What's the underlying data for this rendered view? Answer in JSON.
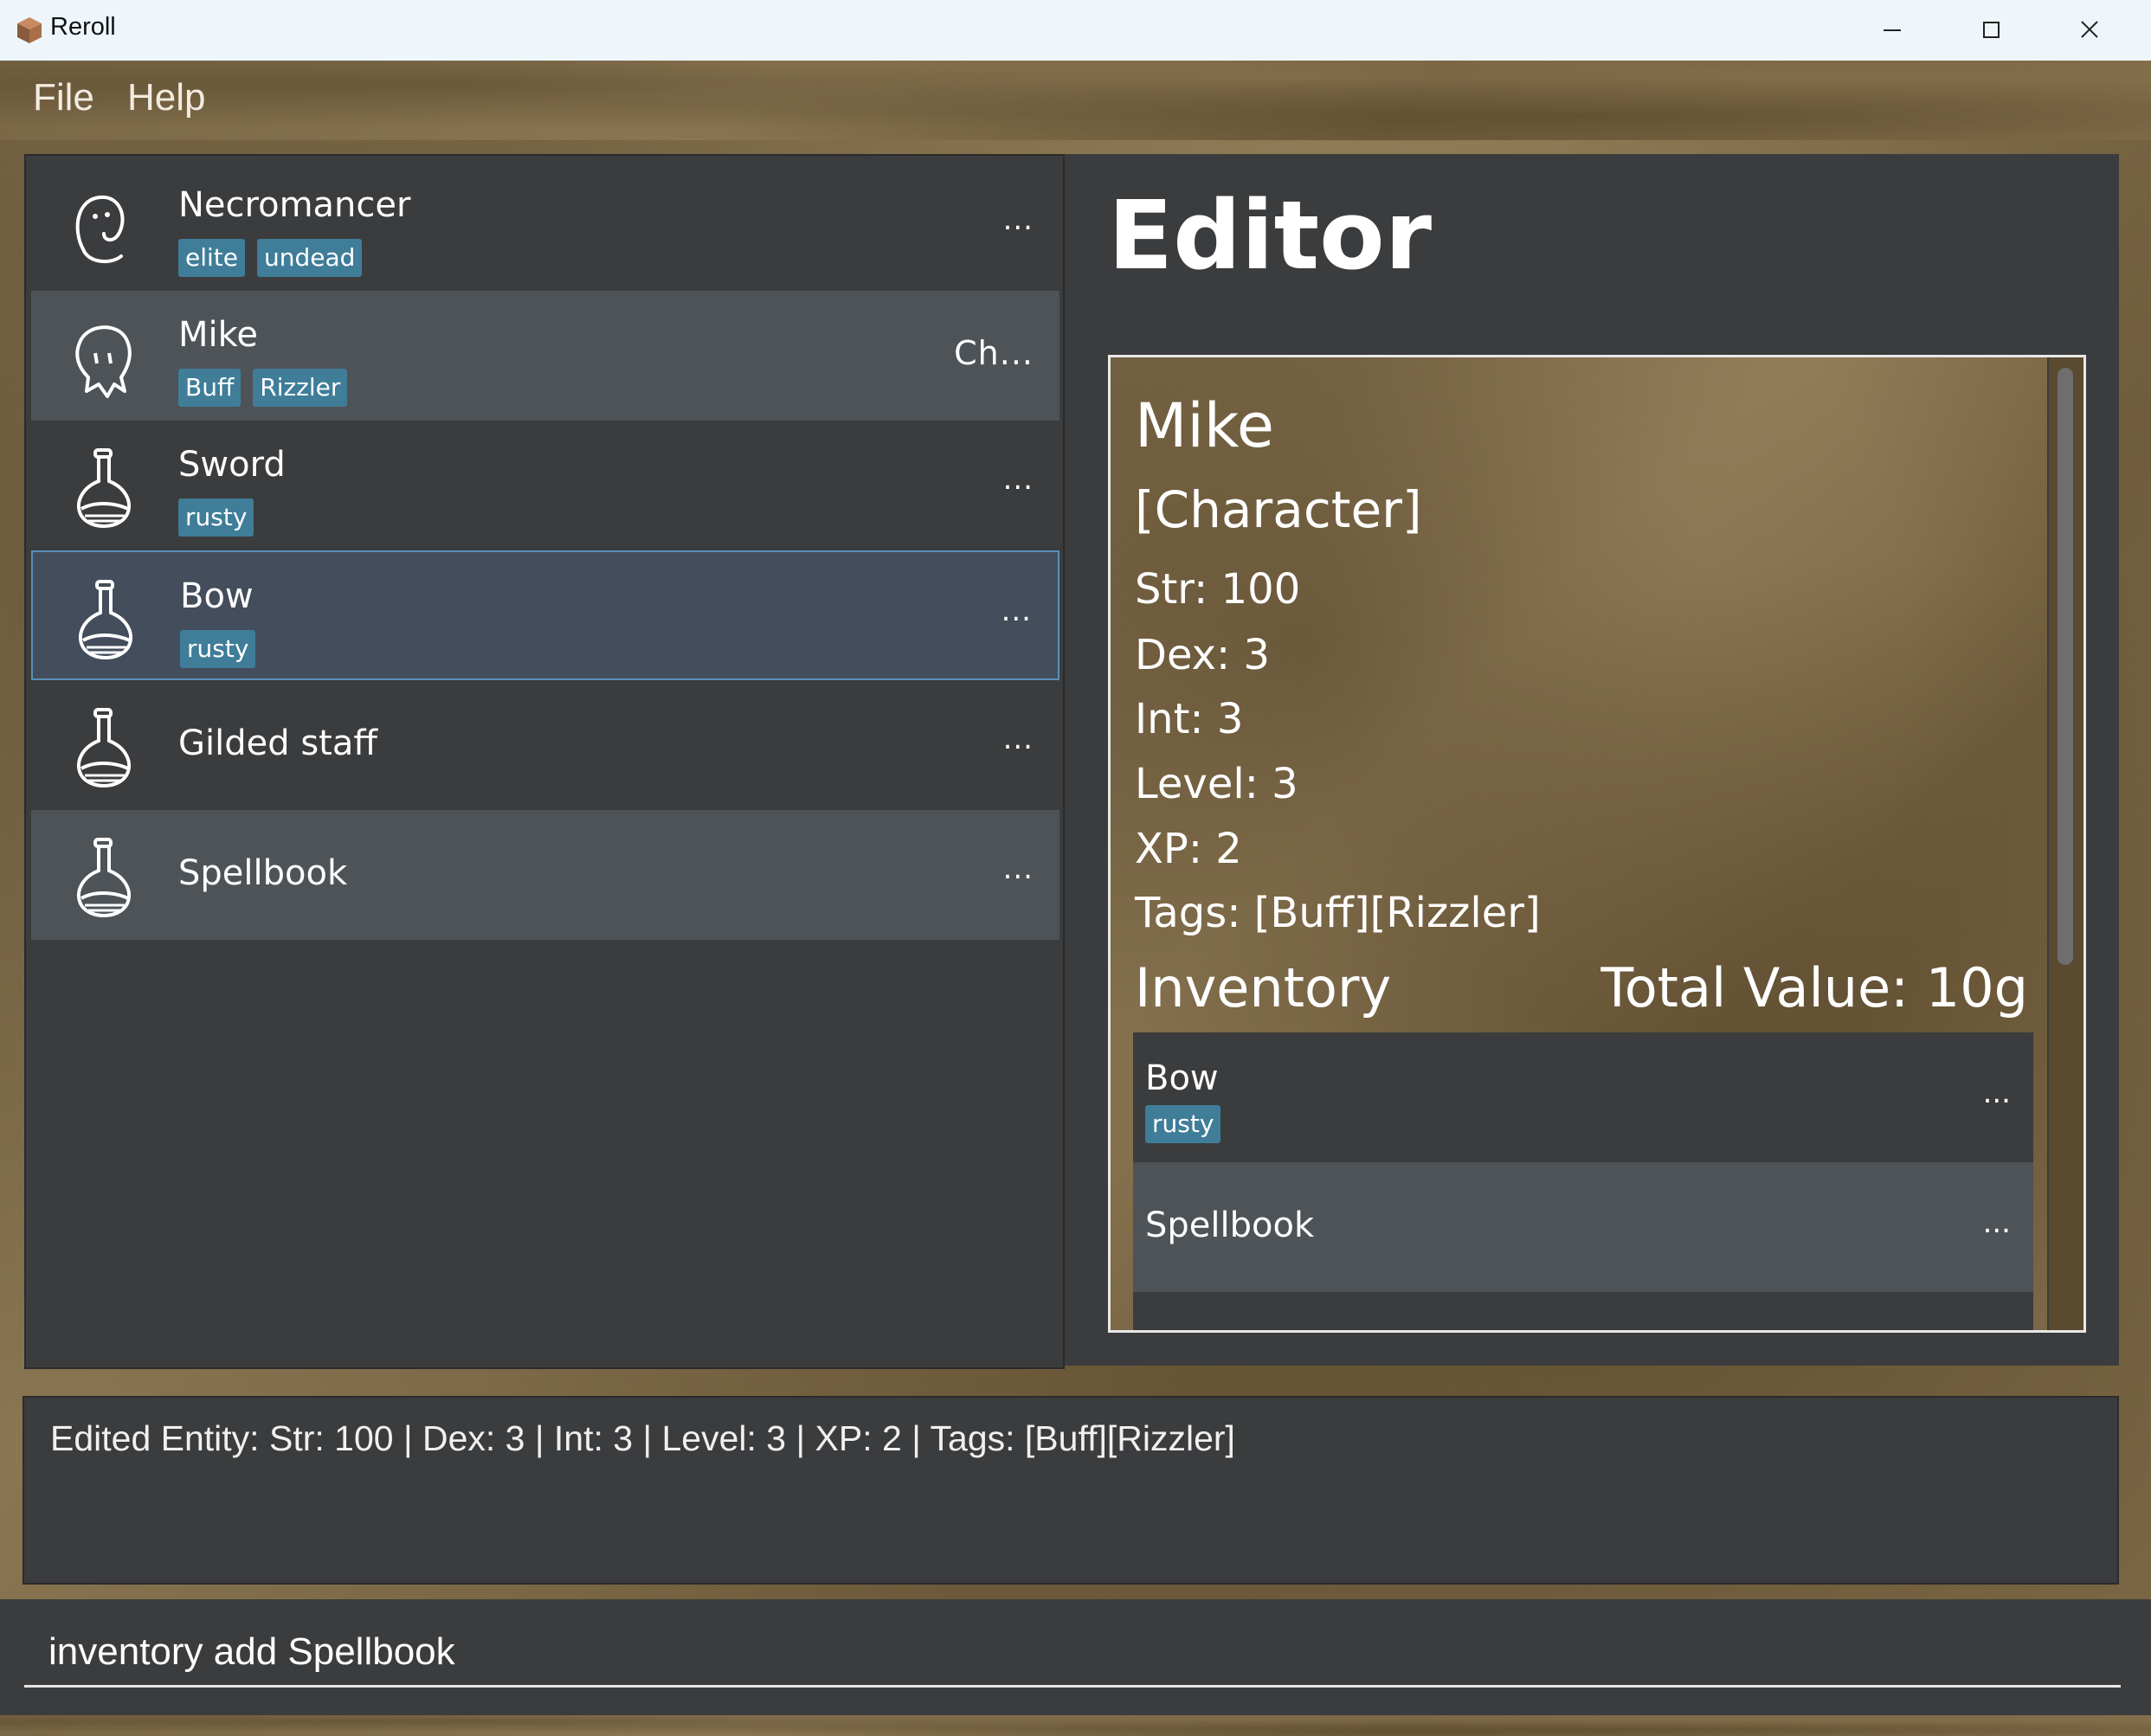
{
  "window": {
    "title": "Reroll",
    "minimize_icon": "minimize-icon",
    "maximize_icon": "maximize-icon",
    "close_icon": "close-icon"
  },
  "menu": {
    "file": "File",
    "help": "Help"
  },
  "entities": [
    {
      "name": "Necromancer",
      "icon": "ghost-icon",
      "tags": [
        "elite",
        "undead"
      ],
      "more": "...",
      "style": "normal"
    },
    {
      "name": "Mike",
      "icon": "ghost-face-icon",
      "tags": [
        "Buff",
        "Rizzler"
      ],
      "more": "Ch...",
      "style": "alt"
    },
    {
      "name": "Sword",
      "icon": "potion-flask-icon",
      "tags": [
        "rusty"
      ],
      "more": "...",
      "style": "normal"
    },
    {
      "name": "Bow",
      "icon": "potion-flask-icon",
      "tags": [
        "rusty"
      ],
      "more": "...",
      "style": "selected"
    },
    {
      "name": "Gilded staff",
      "icon": "potion-flask-icon",
      "tags": [],
      "more": "...",
      "style": "normal"
    },
    {
      "name": "Spellbook",
      "icon": "potion-flask-icon",
      "tags": [],
      "more": "...",
      "style": "alt"
    }
  ],
  "editor": {
    "title": "Editor",
    "name": "Mike",
    "type": "[Character]",
    "str": "Str: 100",
    "dex": "Dex: 3",
    "int": "Int: 3",
    "level": "Level: 3",
    "xp": "XP: 2",
    "tags": "Tags: [Buff][Rizzler]",
    "inventory_label": "Inventory",
    "total_value": "Total Value: 10g",
    "inventory": [
      {
        "name": "Bow",
        "tags": [
          "rusty"
        ],
        "more": "..."
      },
      {
        "name": "Spellbook",
        "tags": [],
        "more": "..."
      }
    ]
  },
  "result": "Edited Entity: Str: 100 | Dex: 3 | Int: 3 | Level: 3 | XP: 2 | Tags: [Buff][Rizzler]",
  "command": {
    "value": "inventory add Spellbook"
  },
  "colors": {
    "accent": "#3f7d99",
    "panel": "#3b3c3e",
    "selected_border": "#5a8fb8"
  }
}
